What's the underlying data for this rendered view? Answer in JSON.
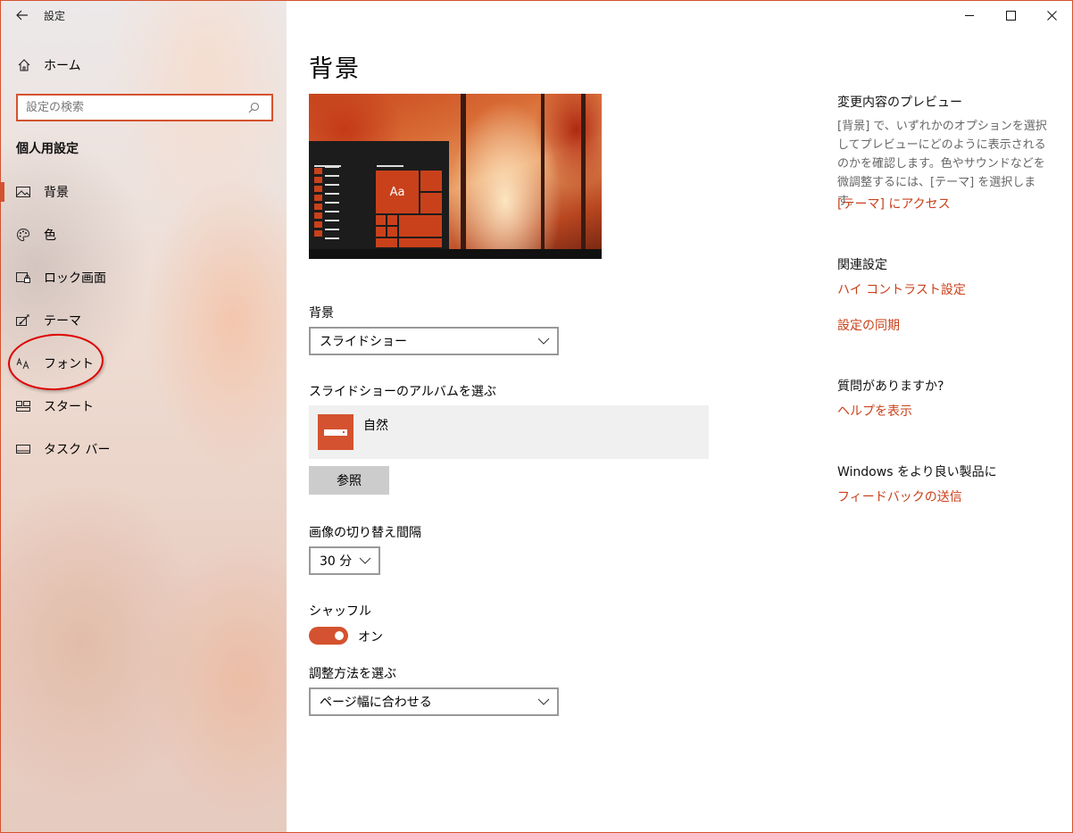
{
  "app": {
    "title": "設定"
  },
  "window_controls": {
    "minimize": "—",
    "maximize": "☐",
    "close": "✕"
  },
  "sidebar": {
    "home_label": "ホーム",
    "search_placeholder": "設定の検索",
    "section_title": "個人用設定",
    "items": [
      {
        "label": "背景",
        "icon": "picture-icon",
        "active": true
      },
      {
        "label": "色",
        "icon": "palette-icon",
        "active": false
      },
      {
        "label": "ロック画面",
        "icon": "lock-screen-icon",
        "active": false
      },
      {
        "label": "テーマ",
        "icon": "theme-icon",
        "active": false
      },
      {
        "label": "フォント",
        "icon": "font-icon",
        "active": false,
        "annotated": true
      },
      {
        "label": "スタート",
        "icon": "start-icon",
        "active": false
      },
      {
        "label": "タスク バー",
        "icon": "taskbar-icon",
        "active": false
      }
    ]
  },
  "main": {
    "title": "背景",
    "preview": {
      "tile_text": "Aa"
    },
    "background_label": "背景",
    "background_value": "スライドショー",
    "album_label": "スライドショーのアルバムを選ぶ",
    "album_name": "自然",
    "browse_label": "参照",
    "interval_label": "画像の切り替え間隔",
    "interval_value": "30 分",
    "shuffle_label": "シャッフル",
    "shuffle_state": "オン",
    "fit_label": "調整方法を選ぶ",
    "fit_value": "ページ幅に合わせる"
  },
  "right": {
    "preview_heading": "変更内容のプレビュー",
    "preview_text": "[背景] で、いずれかのオプションを選択してプレビューにどのように表示されるのかを確認します。色やサウンドなどを微調整するには、[テーマ] を選択します。",
    "themes_link": "[テーマ] にアクセス",
    "related_heading": "関連設定",
    "high_contrast_link": "ハイ コントラスト設定",
    "sync_link": "設定の同期",
    "question_heading": "質問がありますか?",
    "help_link": "ヘルプを表示",
    "feedback_heading": "Windows をより良い製品に",
    "feedback_link": "フィードバックの送信"
  },
  "colors": {
    "accent": "#d4522f",
    "link": "#c9411b",
    "annotation": "#dd0000"
  }
}
